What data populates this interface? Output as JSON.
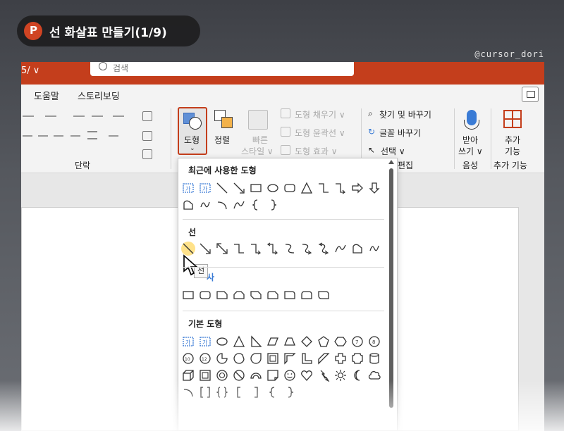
{
  "badge": {
    "title": "선 화살표 만들기(1/9)",
    "app_icon": "powerpoint-icon"
  },
  "watermark": "@cursor_dori",
  "titlebar": {
    "left_text": "5/ ∨",
    "search_placeholder": "검색",
    "accent": "#c43e1c"
  },
  "menubar": {
    "items": [
      "도움말",
      "스토리보딩"
    ]
  },
  "ribbon": {
    "groups": {
      "paragraph": "단락",
      "edit": "편집",
      "voice": "음성",
      "addins_group": "추가 기능"
    },
    "shapes": "도형",
    "arrange": "정렬",
    "quick_styles": [
      "빠른",
      "스타일 ∨"
    ],
    "shape_fill": "도형 채우기 ∨",
    "shape_outline": "도형 윤곽선 ∨",
    "shape_effects": "도형 효과 ∨",
    "find_replace": "찾기 및 바꾸기",
    "replace_fonts": "글꼴 바꾸기",
    "select": "선택 ∨",
    "dictate": [
      "받아",
      "쓰기 ∨"
    ],
    "addins": [
      "추가",
      "기능"
    ]
  },
  "dropdown": {
    "recent": "최근에 사용한 도형",
    "lines": "선",
    "basic": "기본 도형",
    "tooltip": "선",
    "rect_partial": "사"
  }
}
